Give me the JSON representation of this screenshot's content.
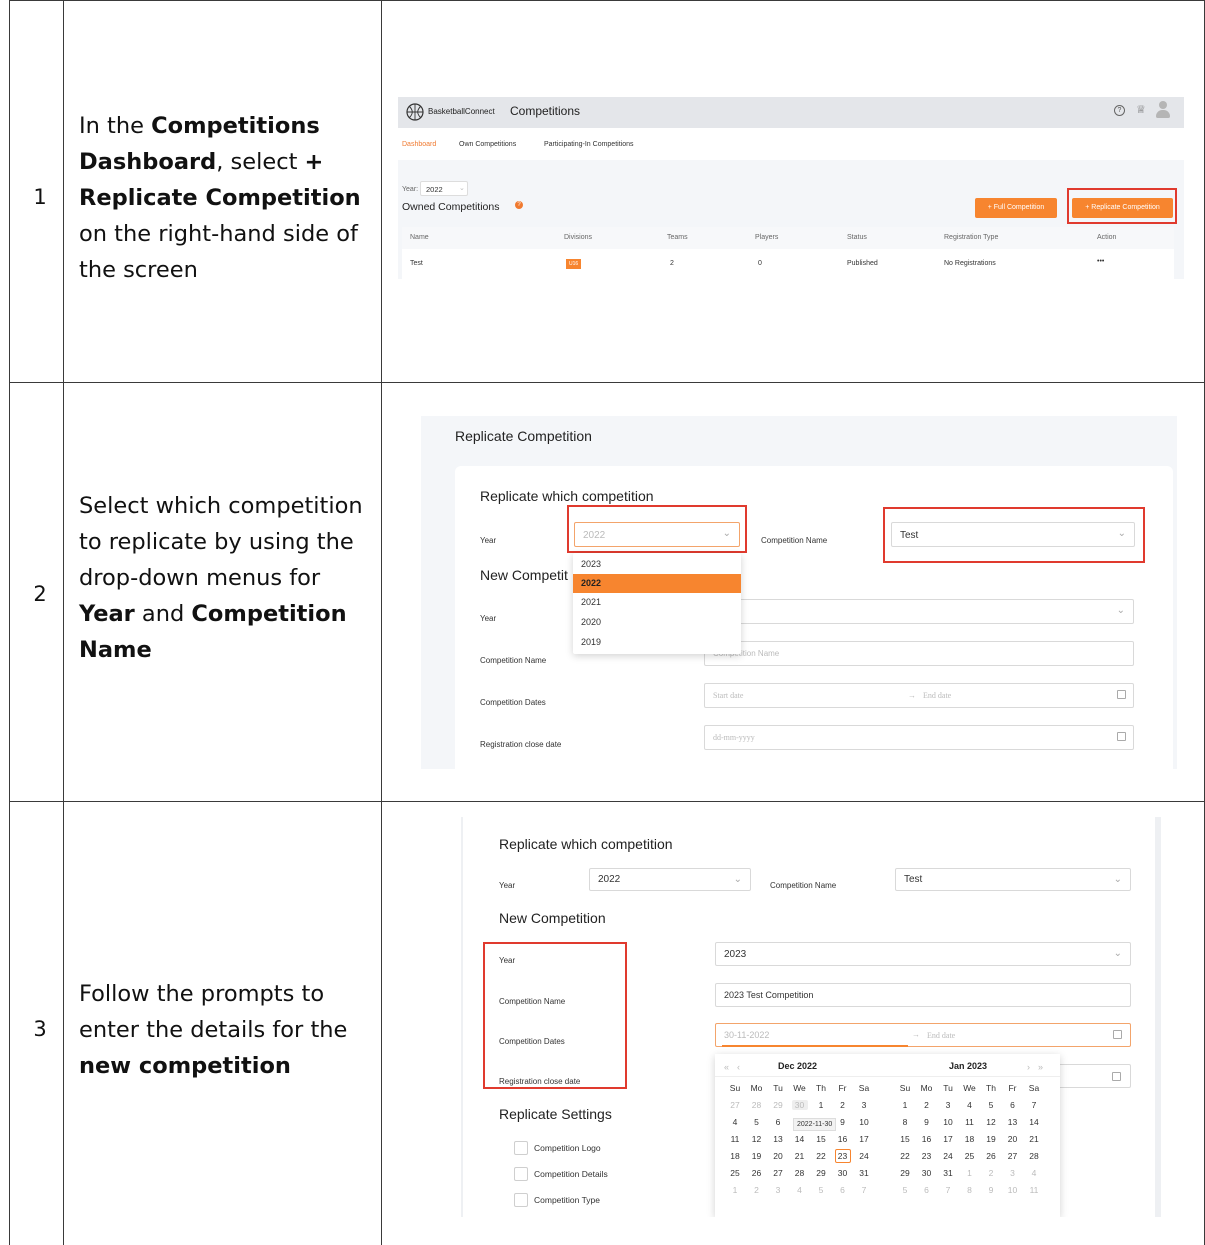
{
  "steps": [
    {
      "number": "1",
      "instruction_parts": [
        "In the ",
        "Competitions Dashboard",
        ", select ",
        "+ Replicate Competition",
        " on the right-hand side of the screen"
      ]
    },
    {
      "number": "2",
      "instruction_parts": [
        "Select which competition to replicate by using the drop-down menus for ",
        "Year",
        " and ",
        "Competition Name",
        ""
      ]
    },
    {
      "number": "3",
      "instruction_parts": [
        "Follow the prompts to enter the details for the ",
        "new competition",
        ""
      ]
    }
  ],
  "shot1": {
    "brand": "BasketballConnect",
    "page_title": "Competitions",
    "tabs": [
      "Dashboard",
      "Own Competitions",
      "Participating-In Competitions"
    ],
    "year_label": "Year:",
    "year_value": "2022",
    "section_title": "Owned Competitions",
    "full_button": "+ Full Competition",
    "replicate_button": "+ Replicate Competition",
    "columns": [
      "Name",
      "Divisions",
      "Teams",
      "Players",
      "Status",
      "Registration Type",
      "Action"
    ],
    "row": {
      "name": "Test",
      "division": "U16",
      "teams": "2",
      "players": "0",
      "status": "Published",
      "registration": "No Registrations",
      "action": "•••"
    }
  },
  "shot2": {
    "title": "Replicate Competition",
    "section1": "Replicate which competition",
    "year_label": "Year",
    "year_value": "2022",
    "comp_name_label": "Competition Name",
    "comp_name_value": "Test",
    "section2": "New Competit",
    "year_options": [
      "2023",
      "2022",
      "2021",
      "2020",
      "2019"
    ],
    "selected_option": "2022",
    "rows": [
      {
        "label": "Year",
        "placeholder": ""
      },
      {
        "label": "Competition Name",
        "placeholder": "Competition Name"
      },
      {
        "label": "Competition Dates",
        "start": "Start date",
        "end": "End date"
      },
      {
        "label": "Registration close date",
        "placeholder": "dd-mm-yyyy"
      }
    ]
  },
  "shot3": {
    "section1": "Replicate which competition",
    "year_label": "Year",
    "year_value": "2022",
    "comp_name_label": "Competition Name",
    "comp_name_value": "Test",
    "section2": "New Competition",
    "labels": [
      "Year",
      "Competition Name",
      "Competition Dates",
      "Registration close date"
    ],
    "new_year": "2023",
    "new_name": "2023 Test Competition",
    "start_date": "30-11-2022",
    "end_date": "End date",
    "section3": "Replicate Settings",
    "settings": [
      "Competition Logo",
      "Competition Details",
      "Competition Type"
    ],
    "calendar": {
      "left_month": "Dec",
      "left_year": "2022",
      "right_month": "Jan",
      "right_year": "2023",
      "weekdays": [
        "Su",
        "Mo",
        "Tu",
        "We",
        "Th",
        "Fr",
        "Sa"
      ],
      "left_days": [
        [
          "27",
          "28",
          "29",
          "30",
          "1",
          "2",
          "3"
        ],
        [
          "4",
          "5",
          "6",
          "7",
          "8",
          "9",
          "10"
        ],
        [
          "11",
          "12",
          "13",
          "14",
          "15",
          "16",
          "17"
        ],
        [
          "18",
          "19",
          "20",
          "21",
          "22",
          "23",
          "24"
        ],
        [
          "25",
          "26",
          "27",
          "28",
          "29",
          "30",
          "31"
        ],
        [
          "1",
          "2",
          "3",
          "4",
          "5",
          "6",
          "7"
        ]
      ],
      "right_days": [
        [
          "1",
          "2",
          "3",
          "4",
          "5",
          "6",
          "7"
        ],
        [
          "8",
          "9",
          "10",
          "11",
          "12",
          "13",
          "14"
        ],
        [
          "15",
          "16",
          "17",
          "18",
          "19",
          "20",
          "21"
        ],
        [
          "22",
          "23",
          "24",
          "25",
          "26",
          "27",
          "28"
        ],
        [
          "29",
          "30",
          "31",
          "1",
          "2",
          "3",
          "4"
        ],
        [
          "5",
          "6",
          "7",
          "8",
          "9",
          "10",
          "11"
        ]
      ],
      "tooltip": "2022-11-30",
      "today": "23"
    }
  }
}
